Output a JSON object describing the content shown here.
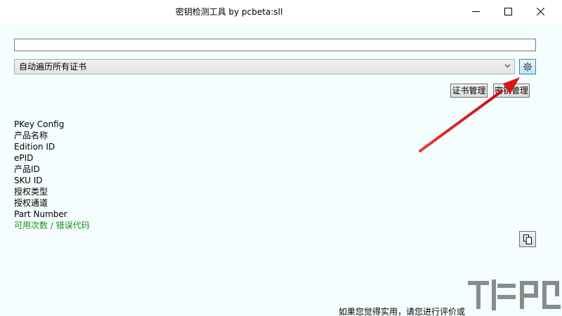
{
  "window": {
    "title": "密钥检测工具 by pcbeta:sll",
    "controls": {
      "minimize": "minimize",
      "maximize": "maximize",
      "close": "close"
    }
  },
  "key_input": {
    "value": "",
    "placeholder": ""
  },
  "cert_select": {
    "selected": "自动遍历所有证书"
  },
  "buttons": {
    "cert_manage": "证书管理",
    "key_manage": "密钥管理"
  },
  "info_fields": [
    "PKey Config",
    "产品名称",
    "Edition ID",
    "ePID",
    "产品ID",
    "SKU ID",
    "授权类型",
    "授权通道",
    "Part Number"
  ],
  "usage_field": "可用次数 / 错误代码",
  "footer_text": "如果您觉得实用，请您进行评价或",
  "colors": {
    "accent_green": "#1c8c1c",
    "annotation_red": "#e01b1b",
    "gear_button": "#bee6fd"
  },
  "icons": {
    "settings": "gear-icon",
    "copy": "copy-icon",
    "dropdown": "chevron-down-icon"
  }
}
